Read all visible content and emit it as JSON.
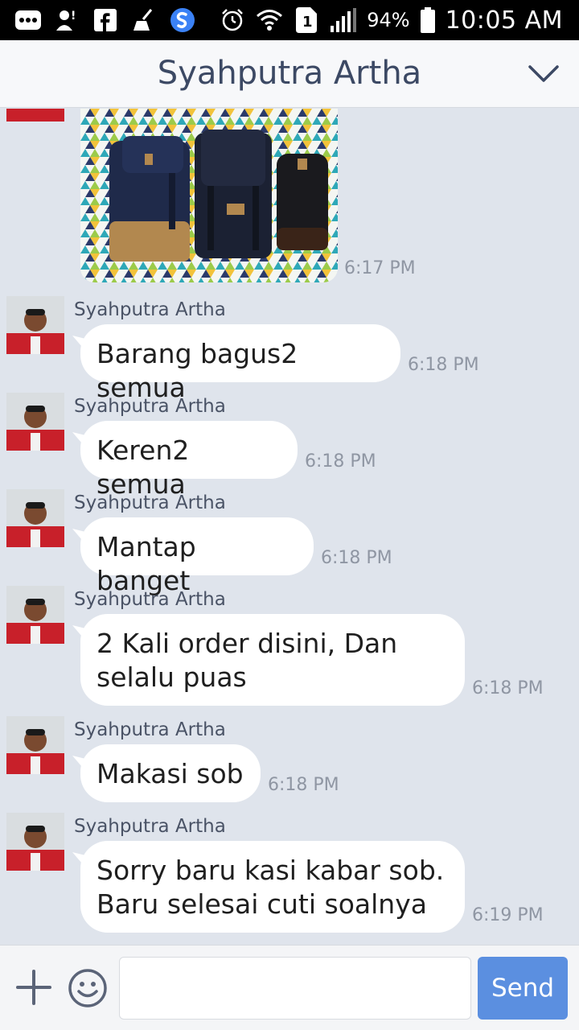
{
  "status_bar": {
    "battery": "94%",
    "time": "10:05 AM",
    "sim_label": "1",
    "icons": [
      "more-icon",
      "person-icon",
      "facebook-icon",
      "broom-icon",
      "shazam-icon",
      "alarm-icon",
      "wifi-icon",
      "sim-icon",
      "signal-icon",
      "battery-icon"
    ]
  },
  "header": {
    "title": "Syahputra Artha",
    "menu_icon": "chevron-down-icon"
  },
  "colors": {
    "background": "#dfe4ec",
    "bubble": "#ffffff",
    "send_button": "#5b8fe0",
    "title": "#3c4964"
  },
  "photo_message": {
    "time": "6:17 PM"
  },
  "messages": [
    {
      "sender": "Syahputra Artha",
      "text": "Barang bagus2 semua",
      "time": "6:18 PM"
    },
    {
      "sender": "Syahputra Artha",
      "text": "Keren2 semua",
      "time": "6:18 PM"
    },
    {
      "sender": "Syahputra Artha",
      "text": "Mantap banget",
      "time": "6:18 PM"
    },
    {
      "sender": "Syahputra Artha",
      "text": "2 Kali order disini, Dan\nselalu puas",
      "time": "6:18 PM"
    },
    {
      "sender": "Syahputra Artha",
      "text": "Makasi sob",
      "time": "6:18 PM"
    },
    {
      "sender": "Syahputra Artha",
      "text": "Sorry baru kasi kabar sob.\nBaru selesai cuti soalnya",
      "time": "6:19 PM"
    }
  ],
  "input_bar": {
    "message_value": "",
    "send_label": "Send"
  }
}
